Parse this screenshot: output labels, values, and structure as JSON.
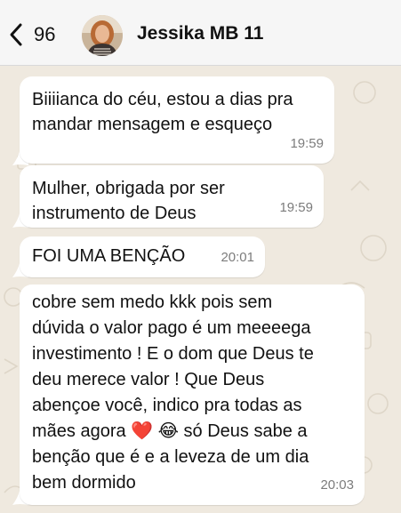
{
  "header": {
    "unread_count": "96",
    "contact_name": "Jessika MB 11"
  },
  "messages": [
    {
      "text": "Biiiianca do céu, estou a dias pra\nmandar mensagem e esqueço",
      "time": "19:59"
    },
    {
      "text": "Mulher, obrigada por ser\ninstrumento de Deus",
      "time": "19:59"
    },
    {
      "text": "FOI UMA BENÇÃO",
      "time": "20:01"
    },
    {
      "text": "cobre sem medo kkk pois sem\ndúvida o valor pago é um meeeega\ninvestimento ! E o dom que Deus te\ndeu merece valor ! Que Deus\nabençoe você, indico pra todas as\nmães agora ❤️ 😂 só Deus sabe a\nbenção que é e a leveza de um dia\nbem dormido",
      "time": "20:03"
    }
  ],
  "colors": {
    "chat_background": "#efe9df",
    "bubble": "#ffffff",
    "timestamp": "#7c7c7c"
  }
}
